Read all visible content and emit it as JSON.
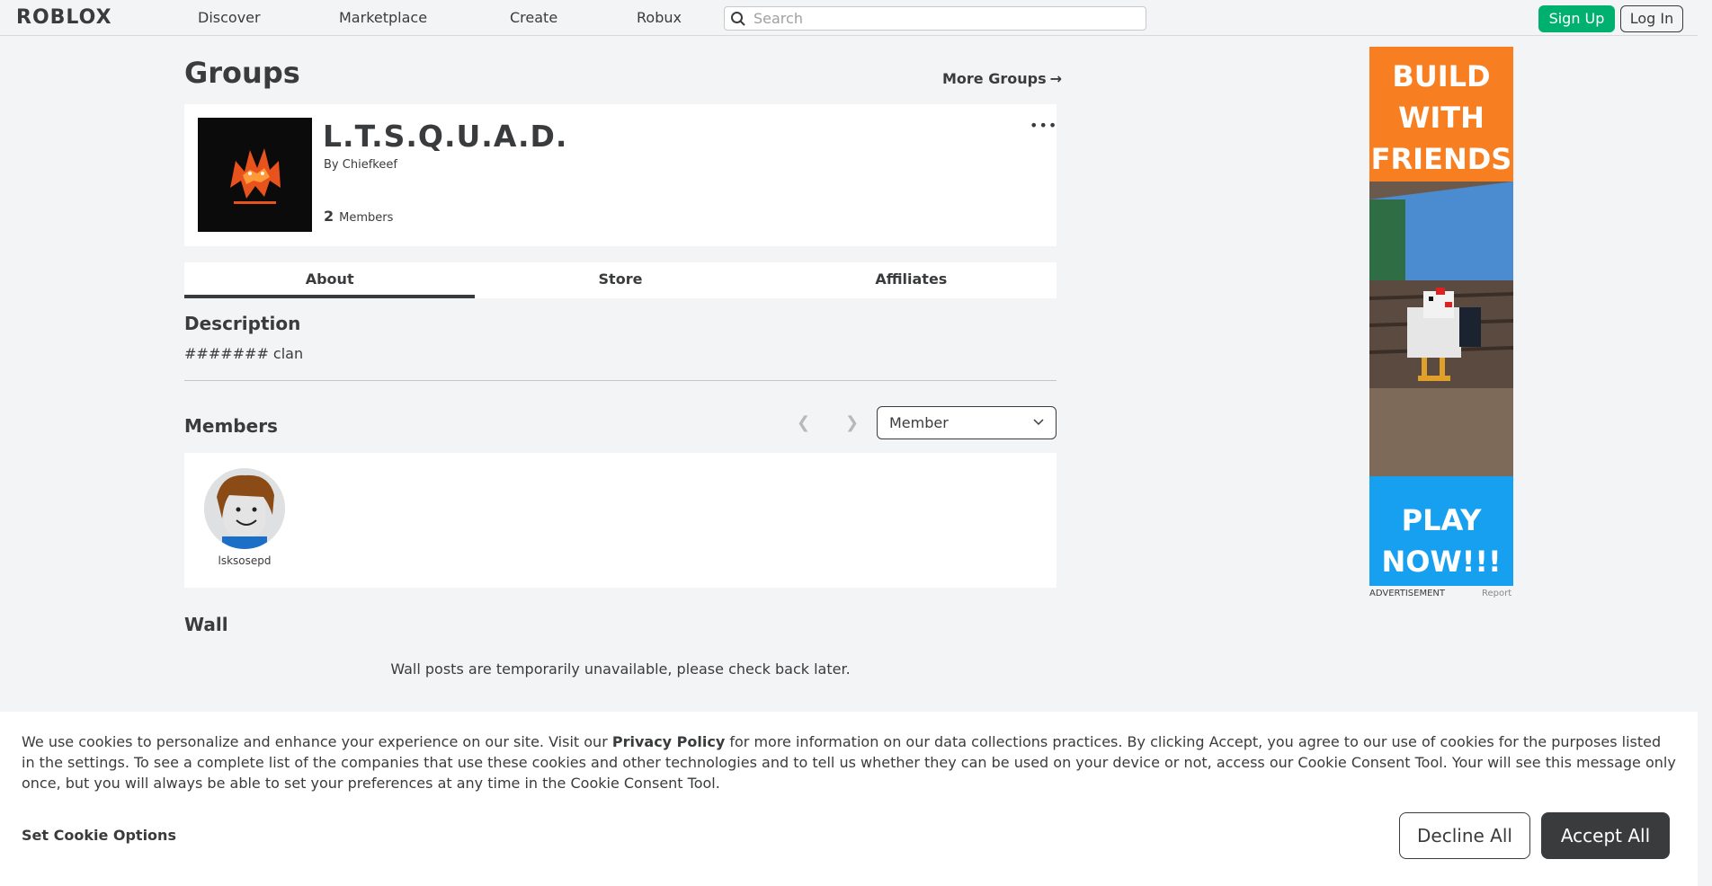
{
  "header": {
    "logo": "ROBLOX",
    "nav": [
      "Discover",
      "Marketplace",
      "Create",
      "Robux"
    ],
    "search_placeholder": "Search",
    "signup_label": "Sign Up",
    "login_label": "Log In"
  },
  "page": {
    "title": "Groups",
    "more_groups": "More Groups",
    "more_groups_arrow": "→"
  },
  "group": {
    "name": "L.T.S.Q.U.A.D.",
    "by_prefix": "By",
    "owner": "Chiefkeef",
    "member_count": "2",
    "members_label": "Members",
    "menu_icon": "•••"
  },
  "tabs": [
    "About",
    "Store",
    "Affiliates"
  ],
  "description": {
    "title": "Description",
    "text": "####### clan"
  },
  "members": {
    "title": "Members",
    "role_selected": "Member",
    "list": [
      {
        "username": "lsksosepd"
      }
    ]
  },
  "wall": {
    "title": "Wall",
    "message": "Wall posts are temporarily unavailable, please check back later."
  },
  "ad": {
    "headline_lines": [
      "BUILD",
      "WITH",
      "FRIENDS"
    ],
    "cta_lines": [
      "PLAY",
      "NOW!!!"
    ],
    "label": "ADVERTISEMENT",
    "report": "Report"
  },
  "cookie": {
    "text_before": "We use cookies to personalize and enhance your experience on our site. Visit our ",
    "policy_link": "Privacy Policy",
    "text_after": " for more information on our data collections practices. By clicking Accept, you agree to our use of cookies for the purposes listed in the settings. To see a complete list of the companies that use these cookies and other technologies and to tell us whether they can be used on your device or not, access our Cookie Consent Tool. Your will see this message only once, but you will always be able to set your preferences at any time in the Cookie Consent Tool.",
    "set_options": "Set Cookie Options",
    "decline": "Decline All",
    "accept": "Accept All"
  }
}
